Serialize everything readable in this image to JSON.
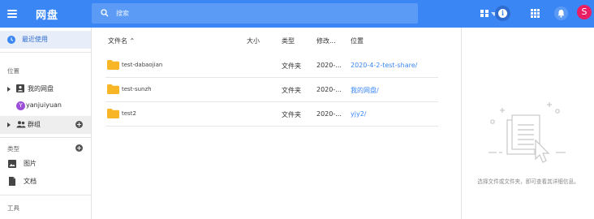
{
  "header": {
    "title": "网盘",
    "search_placeholder": "搜索",
    "avatar_letter": "S",
    "accent": "#3a86f4"
  },
  "sidebar": {
    "recent_label": "最近使用",
    "location_header": "位置",
    "my_drive_label": "我的网盘",
    "user_name": "yanjuiyuan",
    "user_avatar_letter": "Y",
    "groups_label": "群组",
    "type_header": "类型",
    "images_label": "图片",
    "docs_label": "文档",
    "tools_header": "工具"
  },
  "table": {
    "columns": {
      "name": "文件名 ⌃",
      "size": "大小",
      "type": "类型",
      "modified": "修改...",
      "location": "位置"
    },
    "rows": [
      {
        "name": "test-dabaojian",
        "size": "",
        "type": "文件夹",
        "modified": "2020-...",
        "location": "2020-4-2-test-share/"
      },
      {
        "name": "test-sunzh",
        "size": "",
        "type": "文件夹",
        "modified": "2020-...",
        "location": "我的网盘/"
      },
      {
        "name": "test2",
        "size": "",
        "type": "文件夹",
        "modified": "2020-...",
        "location": "yjy2/"
      }
    ]
  },
  "detail": {
    "hint": "选择文件或文件夹，即可查看其详细信息。"
  }
}
